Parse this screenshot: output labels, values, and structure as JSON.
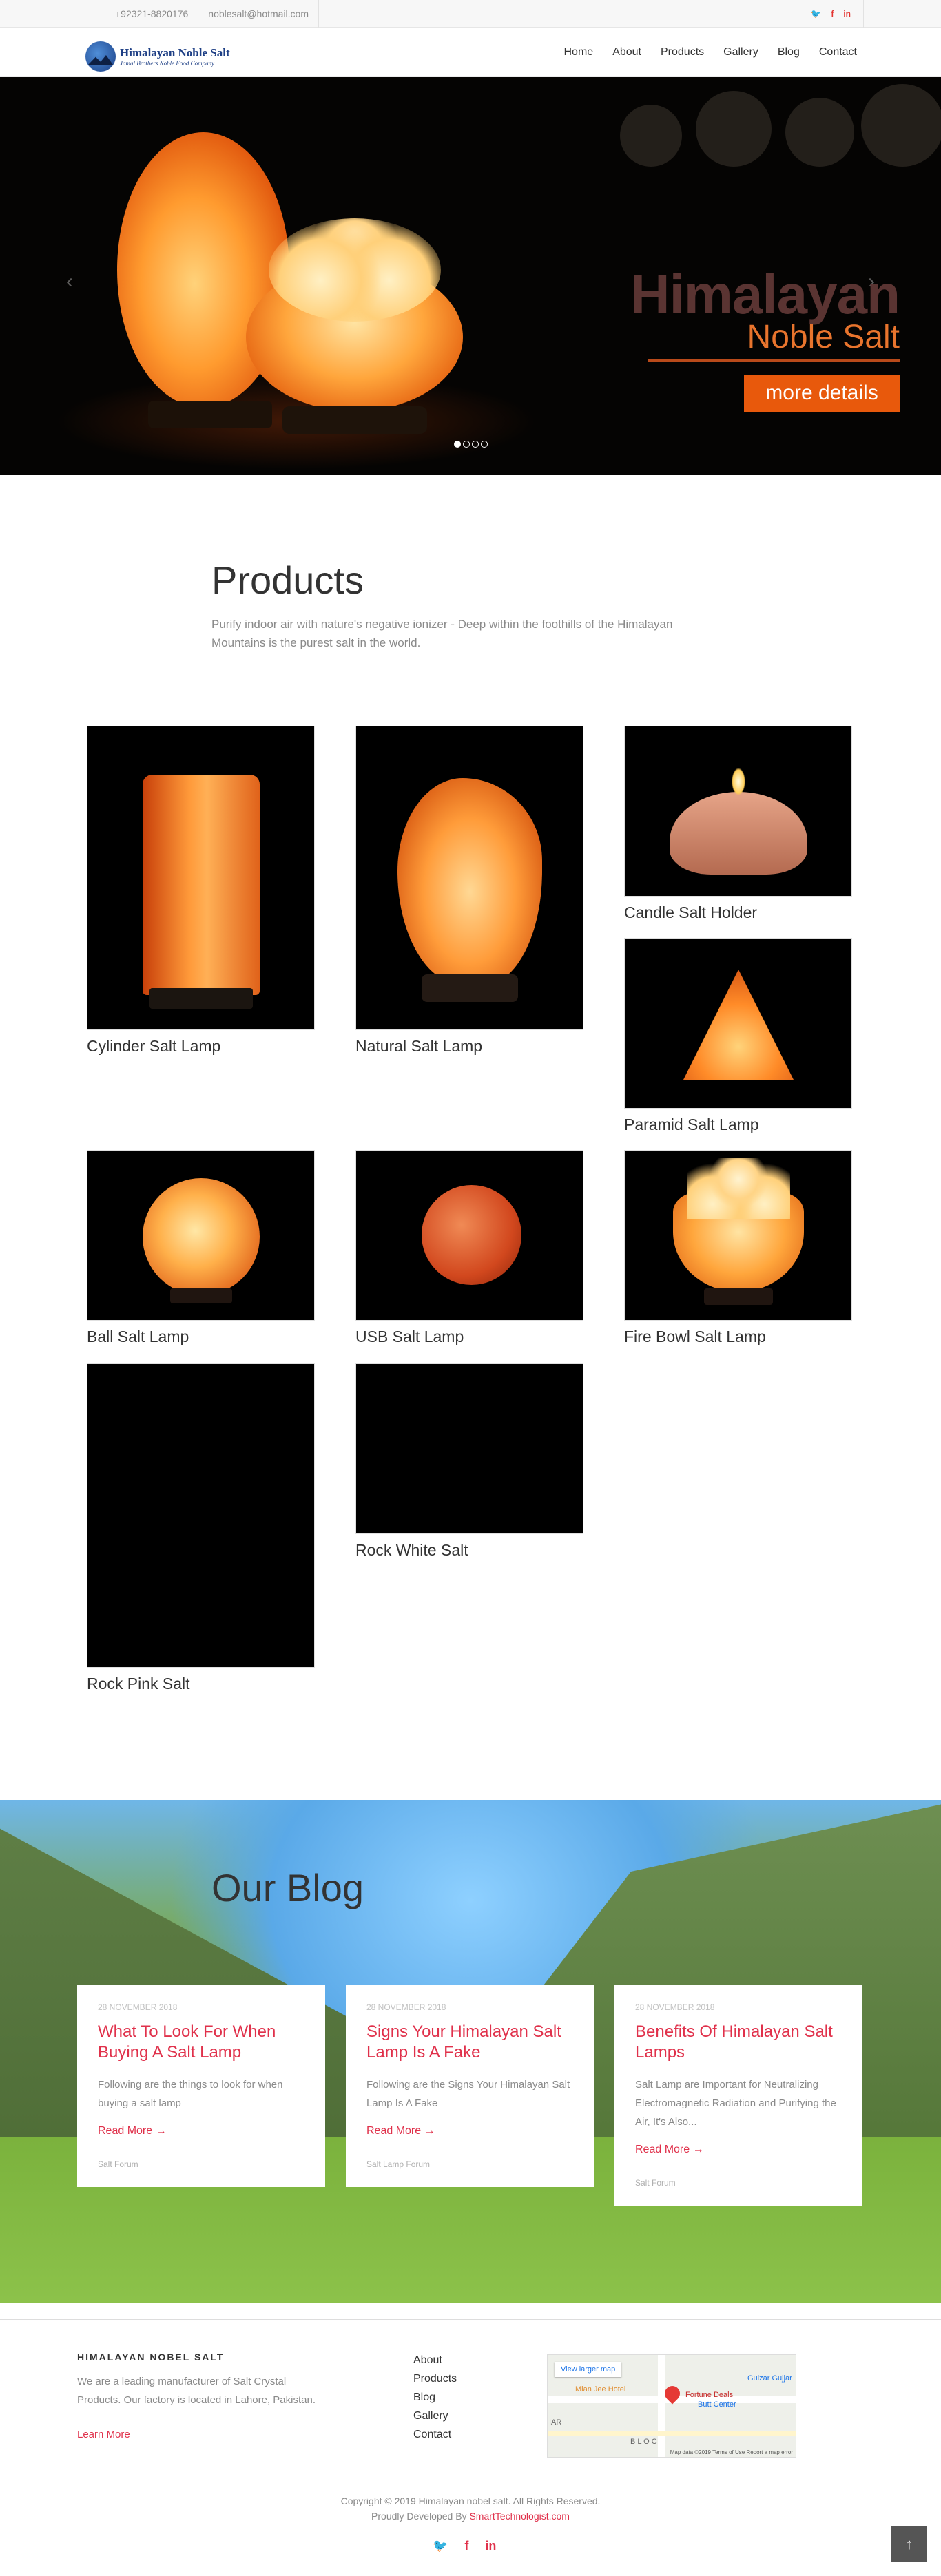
{
  "topbar": {
    "phone": "+92321-8820176",
    "email": "noblesalt@hotmail.com",
    "social": [
      "twitter-icon",
      "facebook-icon",
      "linkedin-icon"
    ]
  },
  "header": {
    "logo_title": "Himalayan Noble Salt",
    "logo_tagline": "Jamal Brothers Noble Food Company",
    "nav": [
      "Home",
      "About",
      "Products",
      "Gallery",
      "Blog",
      "Contact"
    ]
  },
  "hero": {
    "title_line1": "Himalayan",
    "title_line2": "Noble Salt",
    "button": "more details",
    "slide_count": 4,
    "active_slide": 1
  },
  "products": {
    "title": "Products",
    "description": "Purify indoor air with nature's negative ionizer - Deep within the foothills of the Himalayan Mountains is the purest salt in the world.",
    "items": [
      "Cylinder Salt Lamp",
      "Natural Salt Lamp",
      "Candle Salt Holder",
      "Paramid Salt Lamp",
      "Ball Salt Lamp",
      "USB Salt Lamp",
      "Fire Bowl Salt Lamp",
      "Rock Pink Salt",
      "Rock White Salt"
    ]
  },
  "blog": {
    "title": "Our Blog",
    "posts": [
      {
        "date": "28 NOVEMBER 2018",
        "title": "What To Look For When Buying A Salt Lamp",
        "excerpt": "Following are the things to look for when buying a salt lamp",
        "read_more": "Read More →",
        "category": "Salt Forum"
      },
      {
        "date": "28 NOVEMBER 2018",
        "title": "Signs Your Himalayan Salt Lamp Is A Fake",
        "excerpt": "Following are the Signs Your Himalayan Salt Lamp Is A Fake",
        "read_more": "Read More →",
        "category": "Salt Lamp Forum"
      },
      {
        "date": "28 NOVEMBER 2018",
        "title": "Benefits Of Himalayan Salt Lamps",
        "excerpt": "Salt Lamp are Important for Neutralizing Electromagnetic Radiation and Purifying the Air, It's Also...",
        "read_more": "Read More →",
        "category": "Salt Forum"
      }
    ]
  },
  "footer": {
    "heading": "HIMALAYAN NOBEL SALT",
    "about": "We are a leading manufacturer of Salt Crystal Products. Our factory is located in Lahore, Pakistan.",
    "learn_more": "Learn More",
    "links": [
      "About",
      "Products",
      "Blog",
      "Gallery",
      "Contact"
    ],
    "map": {
      "view_larger": "View larger map",
      "place1": "Fortune Deals",
      "place2": "Butt Center",
      "place3": "Mian Jee Hotel",
      "place4": "Gulzar Gujjar",
      "place5": "IAR",
      "place6": "B L O C",
      "copyright": "Map data ©2019   Terms of Use   Report a map error"
    },
    "copyright": "Copyright © 2019 Himalayan nobel salt. All Rights Reserved.",
    "developed_by": "Proudly Developed By",
    "developer": "SmartTechnologist.com",
    "social": [
      "twitter-icon",
      "facebook-icon",
      "linkedin-icon"
    ],
    "to_top": "↑"
  }
}
